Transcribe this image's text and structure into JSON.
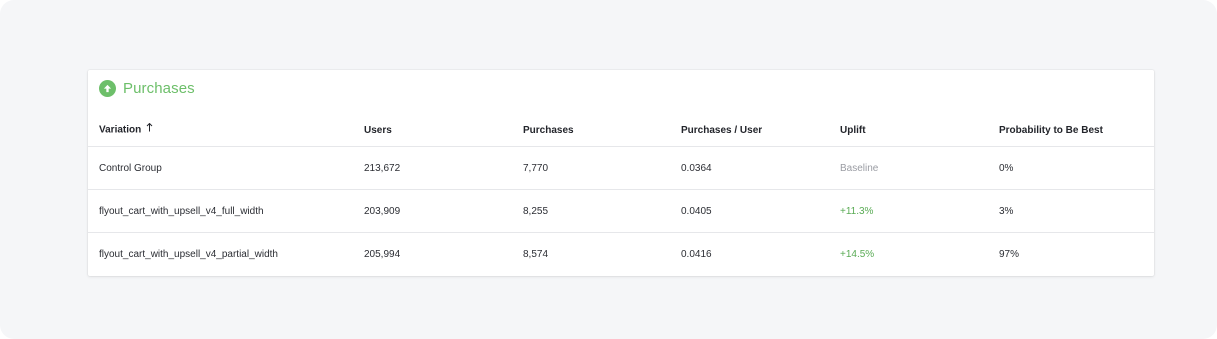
{
  "colors": {
    "accent": "#6dbf6a",
    "positive": "#5aab55",
    "muted": "#9a9ca3",
    "background": "#f5f6f8"
  },
  "goal": {
    "title": "Purchases",
    "icon": "arrow-up-circle-icon"
  },
  "table": {
    "headers": {
      "variation": "Variation",
      "users": "Users",
      "purchases": "Purchases",
      "per_user": "Purchases / User",
      "uplift": "Uplift",
      "probability": "Probability to Be Best"
    },
    "sort_icon": "arrow-up-icon",
    "rows": [
      {
        "variation": "Control Group",
        "users": "213,672",
        "purchases": "7,770",
        "per_user": "0.0364",
        "uplift": "Baseline",
        "probability": "0%"
      },
      {
        "variation": "flyout_cart_with_upsell_v4_full_width",
        "users": "203,909",
        "purchases": "8,255",
        "per_user": "0.0405",
        "uplift": "+11.3%",
        "probability": "3%"
      },
      {
        "variation": "flyout_cart_with_upsell_v4_partial_width",
        "users": "205,994",
        "purchases": "8,574",
        "per_user": "0.0416",
        "uplift": "+14.5%",
        "probability": "97%"
      }
    ]
  }
}
